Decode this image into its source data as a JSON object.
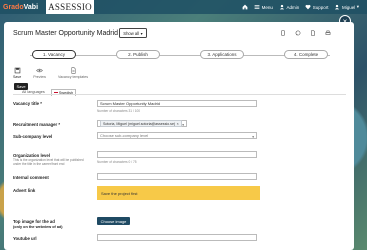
{
  "brand": {
    "name_part1": "Grado",
    "name_part2": "Vabi",
    "partner": "ASSESSIO"
  },
  "topnav": {
    "menu": "Menu",
    "admin": "Admin",
    "support": "Support",
    "user": "Miguel"
  },
  "modal": {
    "title": "Scrum Master Opportunity Madrid",
    "show_all_label": "Show all",
    "close_symbol": "×"
  },
  "steps": [
    {
      "label": "1. Vacancy"
    },
    {
      "label": "2. Publish"
    },
    {
      "label": "3. Applications"
    },
    {
      "label": "4. Complete"
    }
  ],
  "tools": {
    "save": "Save",
    "preview": "Preview",
    "vacancy_templates": "Vacancy templates",
    "tooltip": "Save"
  },
  "lang_tabs": {
    "first": "All languages",
    "second": "Swedish"
  },
  "form": {
    "vacancy_title_label": "Vacancy title *",
    "vacancy_title_value": "Scrum Master Opportunity Madrid",
    "vacancy_title_hint": "Number of characters 31 / 100",
    "recruitment_manager_label": "Recruitment manager *",
    "recruitment_manager_value": "Sotoria, Miguel (miguel.sotoria@assessio.se)",
    "sub_company_label": "Sub-company level",
    "sub_company_placeholder": "Choose sub-company level",
    "organization_label": "Organization level",
    "organization_sub": "This is the organization level that will be published under the title in the career/front end",
    "organization_hint": "Number of characters 0 / 75",
    "internal_comment_label": "Internal comment",
    "advert_link_label": "Advert link",
    "advert_notice": "Save the project first",
    "top_image_label": "Top image for the ad",
    "top_image_sub": "(only on the webview of ad)",
    "choose_image": "Choose image",
    "youtube_label": "Youtube url"
  },
  "colors": {
    "accent": "#1f4a63",
    "notice": "#f7c948",
    "brand_orange": "#ff7a45"
  }
}
